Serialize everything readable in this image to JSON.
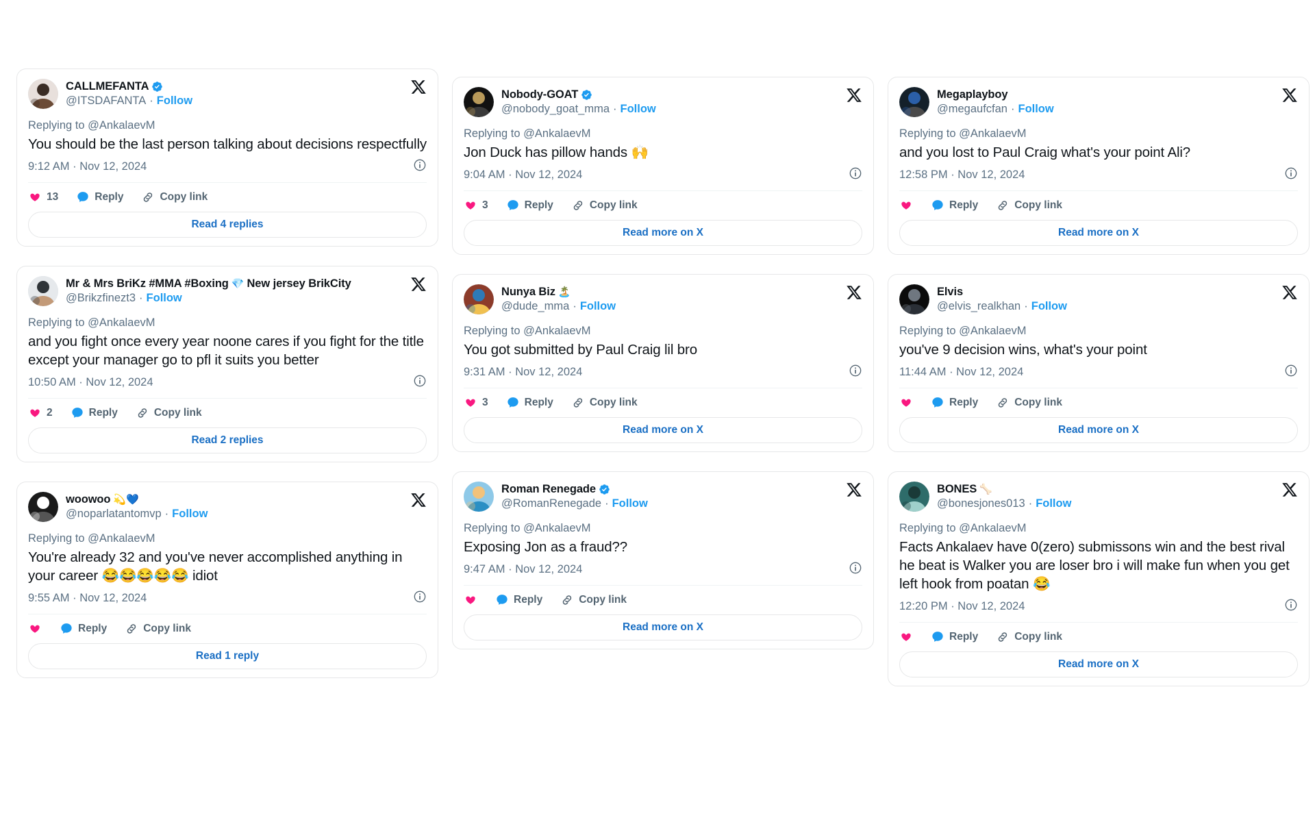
{
  "reply_prefix": "Replying to @AnkalaevM",
  "colors": {
    "like": "#f91880",
    "reply": "#1d9bf0",
    "link_blue": "#1d9bf0",
    "read_more_blue": "#1a6fc4",
    "text": "#0f1419",
    "muted": "#5b7083",
    "border": "#e6e7e8",
    "verified": "#1d9bf0"
  },
  "labels": {
    "reply": "Reply",
    "copy_link": "Copy link",
    "follow": "Follow",
    "separator": "·"
  },
  "columns": [
    {
      "id": "column-1",
      "tweets": [
        {
          "id": "tweet-callmefanta",
          "display_name": "CALLMEFANTA",
          "name_emoji": "",
          "verified": true,
          "handle": "@ITSDAFANTA",
          "replying_to": "Replying to @AnkalaevM",
          "text": "You should be the last person talking about decisions respectfully",
          "timestamp": "9:12 AM · Nov 12, 2024",
          "like_count": "13",
          "show_info": true,
          "footer_label": "Read 4 replies",
          "footer_align": "center",
          "avatar_style": "callmefanta"
        },
        {
          "id": "tweet-brikz",
          "display_name": "Mr & Mrs BriKz #MMA #Boxing",
          "name_emoji": "💎",
          "name_suffix": "New jersey BrikCity",
          "verified": false,
          "handle": "@Brikzfinezt3",
          "replying_to": "Replying to @AnkalaevM",
          "text": "and you fight once every year noone cares if you fight for the title except your manager go to pfl it suits you better",
          "timestamp": "10:50 AM · Nov 12, 2024",
          "like_count": "2",
          "show_info": true,
          "footer_label": "Read 2 replies",
          "footer_align": "center",
          "avatar_style": "brikz"
        },
        {
          "id": "tweet-woowoo",
          "display_name": "woowoo",
          "name_emoji": "💫💙",
          "verified": false,
          "handle": "@noparlatantomvp",
          "replying_to": "Replying to @AnkalaevM",
          "text": "You're already 32 and you've never accomplished anything in your career 😂😂😂😂😂 idiot",
          "timestamp": "9:55 AM · Nov 12, 2024",
          "like_count": "",
          "show_info": true,
          "footer_label": "Read 1 reply",
          "footer_align": "center",
          "avatar_style": "woowoo"
        }
      ]
    },
    {
      "id": "column-2",
      "tweets": [
        {
          "id": "tweet-nobody-goat",
          "display_name": "Nobody-GOAT",
          "name_emoji": "",
          "verified": true,
          "handle": "@nobody_goat_mma",
          "replying_to": "Replying to @AnkalaevM",
          "text": "Jon Duck has pillow hands 🙌",
          "timestamp": "9:04 AM · Nov 12, 2024",
          "like_count": "3",
          "show_info": true,
          "footer_label": "Read more on X",
          "footer_align": "center",
          "avatar_style": "ufc"
        },
        {
          "id": "tweet-nunya-biz",
          "display_name": "Nunya Biz",
          "name_emoji": "🏝️",
          "verified": false,
          "handle": "@dude_mma",
          "replying_to": "Replying to @AnkalaevM",
          "text": "You got submitted by Paul Craig lil bro",
          "timestamp": "9:31 AM · Nov 12, 2024",
          "like_count": "3",
          "show_info": true,
          "footer_label": "Read more on X",
          "footer_align": "center",
          "avatar_style": "nunya"
        },
        {
          "id": "tweet-roman-renegade",
          "display_name": "Roman Renegade",
          "name_emoji": "",
          "verified": true,
          "handle": "@RomanRenegade",
          "replying_to": "Replying to @AnkalaevM",
          "text": "Exposing Jon as a fraud??",
          "timestamp": "9:47 AM · Nov 12, 2024",
          "like_count": "",
          "show_info": true,
          "footer_label": "Read more on X",
          "footer_align": "center",
          "avatar_style": "roman"
        }
      ]
    },
    {
      "id": "column-3",
      "tweets": [
        {
          "id": "tweet-megaplayboy",
          "display_name": "Megaplayboy",
          "name_emoji": "",
          "verified": false,
          "handle": "@megaufcfan",
          "replying_to": "Replying to @AnkalaevM",
          "text": "and you lost to Paul Craig what's your point Ali?",
          "timestamp": "12:58 PM · Nov 12, 2024",
          "like_count": "",
          "show_info": true,
          "footer_label": "Read more on X",
          "footer_align": "center",
          "avatar_style": "mega"
        },
        {
          "id": "tweet-elvis",
          "display_name": "Elvis",
          "name_emoji": "",
          "verified": false,
          "handle": "@elvis_realkhan",
          "replying_to": "Replying to @AnkalaevM",
          "text": "you've 9 decision wins, what's your point",
          "timestamp": "11:44 AM · Nov 12, 2024",
          "like_count": "",
          "show_info": true,
          "footer_label": "Read more on X",
          "footer_align": "center",
          "avatar_style": "elvis"
        },
        {
          "id": "tweet-bones",
          "display_name": "BONES",
          "name_emoji": "🦴",
          "verified": false,
          "handle": "@bonesjones013",
          "replying_to": "Replying to @AnkalaevM",
          "text": "Facts Ankalaev have 0(zero) submissons win  and the best rival he beat is Walker you are loser bro i will make fun when you get left hook from poatan 😂",
          "timestamp": "12:20 PM · Nov 12, 2024",
          "like_count": "",
          "show_info": true,
          "footer_label": "Read more on X",
          "footer_align": "center",
          "avatar_style": "bones"
        }
      ]
    }
  ]
}
